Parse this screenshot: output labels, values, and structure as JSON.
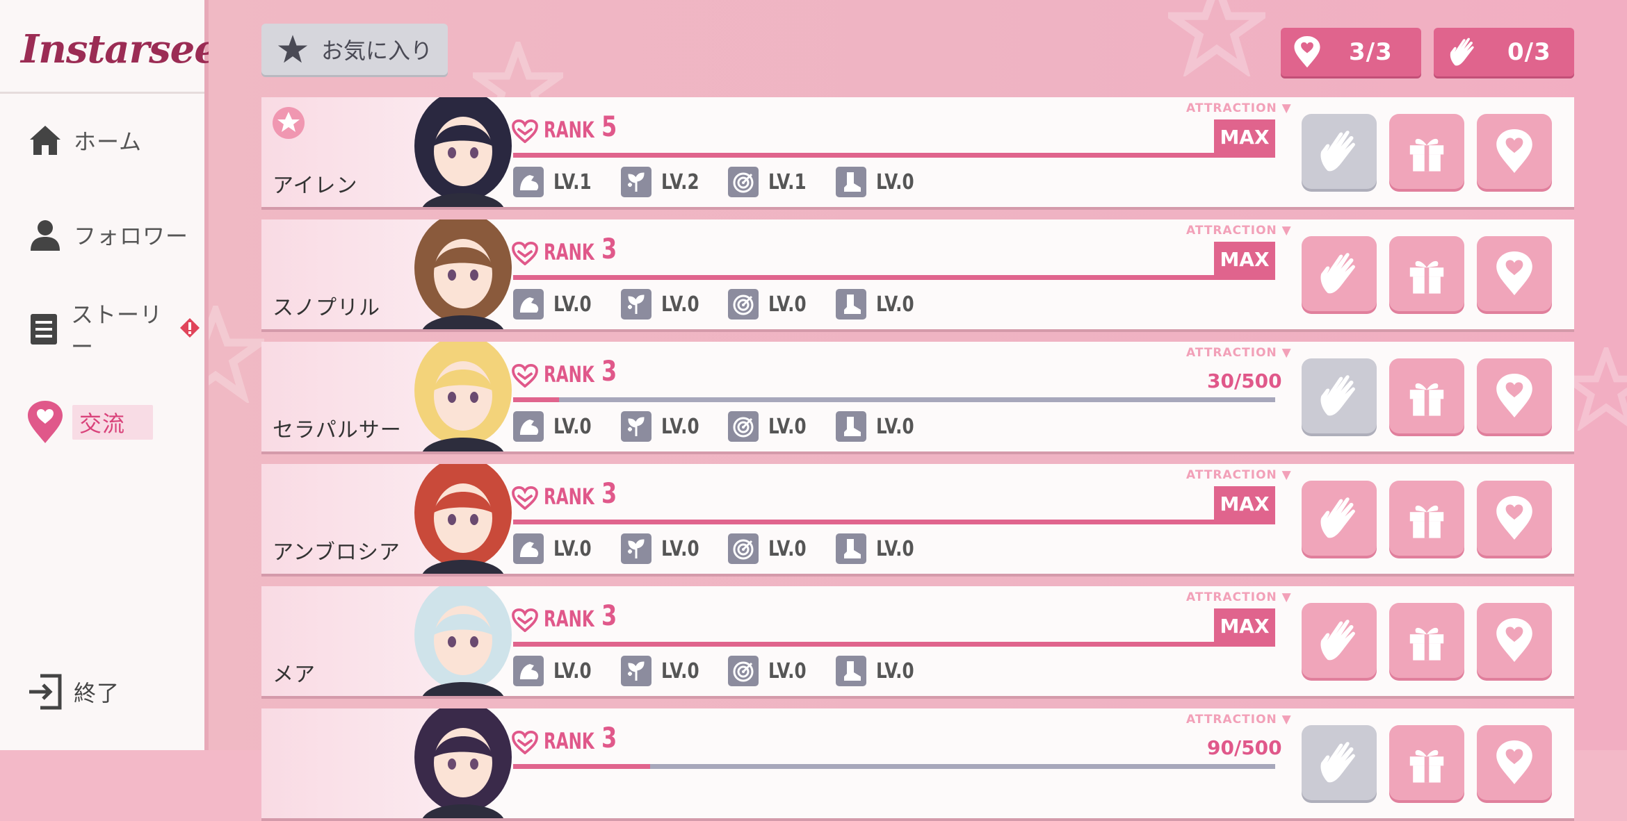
{
  "app": {
    "logo": "Instarseed"
  },
  "sidebar": {
    "items": [
      {
        "label": "ホーム",
        "icon": "home-icon"
      },
      {
        "label": "フォロワー",
        "icon": "person-icon"
      },
      {
        "label": "ストーリー",
        "icon": "document-icon",
        "alert": true
      },
      {
        "label": "交流",
        "icon": "heart-pin-icon",
        "active": true
      }
    ],
    "exit_label": "終了"
  },
  "header": {
    "favorites_label": "お気に入り",
    "heart_count": "3/3",
    "wave_count": "0/3"
  },
  "colors": {
    "accent": "#e0648d",
    "bar_track": "#a7a7bb",
    "disabled": "#cbcbd4"
  },
  "characters": [
    {
      "name": "アイレン",
      "rank_label": "RANK",
      "rank": "5",
      "attraction_label": "ATTRACTION",
      "status": "MAX",
      "progress": 1.0,
      "favorite": true,
      "wave_disabled": true,
      "stats": [
        "LV.1",
        "LV.2",
        "LV.1",
        "LV.0"
      ]
    },
    {
      "name": "スノプリル",
      "rank_label": "RANK",
      "rank": "3",
      "attraction_label": "ATTRACTION",
      "status": "MAX",
      "progress": 1.0,
      "favorite": false,
      "wave_disabled": false,
      "stats": [
        "LV.0",
        "LV.0",
        "LV.0",
        "LV.0"
      ]
    },
    {
      "name": "セラパルサー",
      "rank_label": "RANK",
      "rank": "3",
      "attraction_label": "ATTRACTION",
      "status": "30/500",
      "progress": 0.06,
      "favorite": false,
      "wave_disabled": true,
      "stats": [
        "LV.0",
        "LV.0",
        "LV.0",
        "LV.0"
      ]
    },
    {
      "name": "アンブロシア",
      "rank_label": "RANK",
      "rank": "3",
      "attraction_label": "ATTRACTION",
      "status": "MAX",
      "progress": 1.0,
      "favorite": false,
      "wave_disabled": false,
      "stats": [
        "LV.0",
        "LV.0",
        "LV.0",
        "LV.0"
      ]
    },
    {
      "name": "メア",
      "rank_label": "RANK",
      "rank": "3",
      "attraction_label": "ATTRACTION",
      "status": "MAX",
      "progress": 1.0,
      "favorite": false,
      "wave_disabled": false,
      "stats": [
        "LV.0",
        "LV.0",
        "LV.0",
        "LV.0"
      ]
    },
    {
      "name": "",
      "rank_label": "RANK",
      "rank": "3",
      "attraction_label": "ATTRACTION",
      "status": "90/500",
      "progress": 0.18,
      "favorite": false,
      "wave_disabled": true,
      "stats": [
        "",
        "",
        "",
        ""
      ]
    }
  ]
}
